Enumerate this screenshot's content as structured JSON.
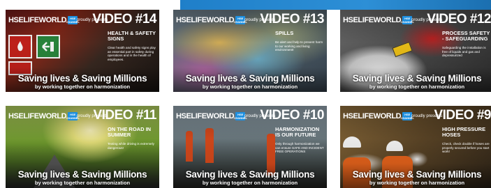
{
  "header": {
    "accent_color": "#2d8fd6"
  },
  "brand": {
    "logo": "HSELIFEWORLD",
    "badge": "HSE CHANNEL",
    "presents": "proudly presents"
  },
  "slogan": {
    "main": "Saving lives & Saving Millions",
    "sub": "by working together on harmonization"
  },
  "videos": [
    {
      "number": "VIDEO #14",
      "topic": "HEALTH & SAFETY SIGNS",
      "description": "Clear health and safety signs play an essential part in safety during operations and in the health of employees."
    },
    {
      "number": "VIDEO #13",
      "topic": "SPILLS",
      "description": "Be alert and help to prevent harm to our working and living environment!"
    },
    {
      "number": "VIDEO #12",
      "topic": "PROCESS SAFETY - SAFEGUARDING",
      "description": "Safeguarding the installation is free of liquids and gas and depressurized"
    },
    {
      "number": "VIDEO #11",
      "topic": "ON THE ROAD IN SUMMER",
      "description": "Texting while driving is extremely dangerous!"
    },
    {
      "number": "VIDEO #10",
      "topic": "HARMONIZATION IS OUR FUTURE",
      "description": "Only through harmonization we can ensure SAFE AND INCIDENT FREE OPERATIONS"
    },
    {
      "number": "VIDEO #9",
      "topic": "HIGH PRESSURE HOSES",
      "description": "Check, check double if hoses are properly secured before you start work!"
    }
  ]
}
